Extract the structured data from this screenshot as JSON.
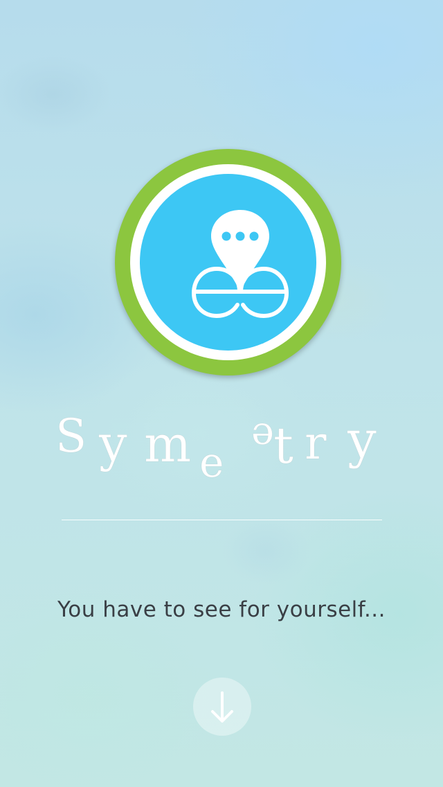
{
  "app": {
    "name": "Symeetry",
    "logo_icon": "eye-pin-logo-icon",
    "tagline": "You have to see for yourself..."
  },
  "wordmark": {
    "letters": [
      "S",
      "y",
      "m",
      "e",
      "e",
      "t",
      "r",
      "y"
    ]
  },
  "scroll_button": {
    "icon": "arrow-down-icon"
  },
  "colors": {
    "logo_outer": "#8cc63f",
    "logo_ring": "#ffffff",
    "logo_inner": "#3dc7f4",
    "text_dark": "#3a3f45"
  }
}
